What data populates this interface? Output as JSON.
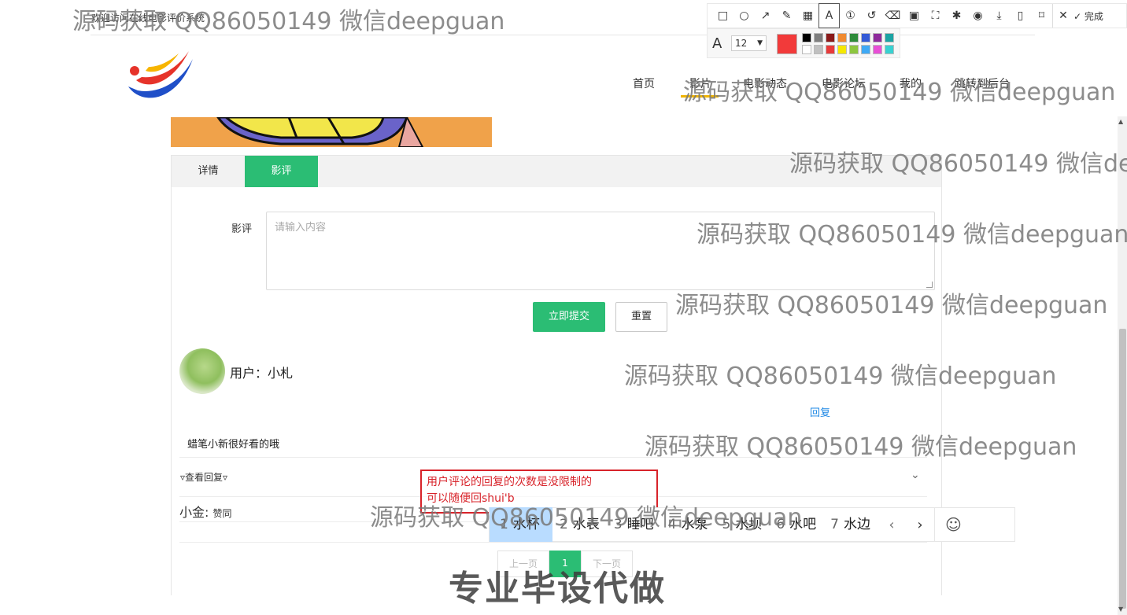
{
  "site": {
    "title": "欢迎访问在线电影评价系统",
    "nav": [
      "首页",
      "影片",
      "电影动态",
      "电影论坛",
      "我的",
      "跳转到后台"
    ]
  },
  "tabs": [
    {
      "label": "详情",
      "active": false
    },
    {
      "label": "影评",
      "active": true
    }
  ],
  "review_form": {
    "label": "影评",
    "placeholder": "请输入内容",
    "submit_label": "立即提交",
    "reset_label": "重置"
  },
  "comment": {
    "user_prefix": "用户：",
    "user_name": "小札",
    "reply_link": "回复",
    "text": "蜡笔小新很好看的哦",
    "toggle_label": "▿查看回复▿",
    "reply_author": "小金:",
    "reply_text": "赞同"
  },
  "annotation": {
    "line1": "用户评论的回复的次数是没限制的",
    "line2": "可以随便回shui'b"
  },
  "ime": {
    "candidates": [
      {
        "num": "1",
        "word": "水杯"
      },
      {
        "num": "2",
        "word": "水表"
      },
      {
        "num": "3",
        "word": "睡吧"
      },
      {
        "num": "4",
        "word": "水泵"
      },
      {
        "num": "5",
        "word": "水坝"
      },
      {
        "num": "6",
        "word": "水吧"
      },
      {
        "num": "7",
        "word": "水边"
      }
    ],
    "prev": "‹",
    "next": "›",
    "emoji": "☺"
  },
  "pagination": {
    "prev": "上一页",
    "current": "1",
    "next": "下一页"
  },
  "screenshot_toolbar": {
    "done_label": "完成",
    "font_size": "12",
    "current_color": "#f23a3a",
    "palette": [
      "#000000",
      "#7f7f7f",
      "#8b1a1a",
      "#f08a30",
      "#2e8b3a",
      "#3359d6",
      "#8e2a9b",
      "#1aa3a3",
      "#ffffff",
      "#c0c0c0",
      "#e83a3a",
      "#f5e800",
      "#8cc63f",
      "#3fa9f5",
      "#e84fd6",
      "#38d1d1"
    ]
  },
  "watermarks": {
    "text": "源码获取 QQ86050149 微信deepguan",
    "bottom": "专业毕设代做"
  },
  "colors": {
    "accent": "#2bbd74",
    "link": "#1e88e5",
    "annotation": "#d8232a"
  }
}
